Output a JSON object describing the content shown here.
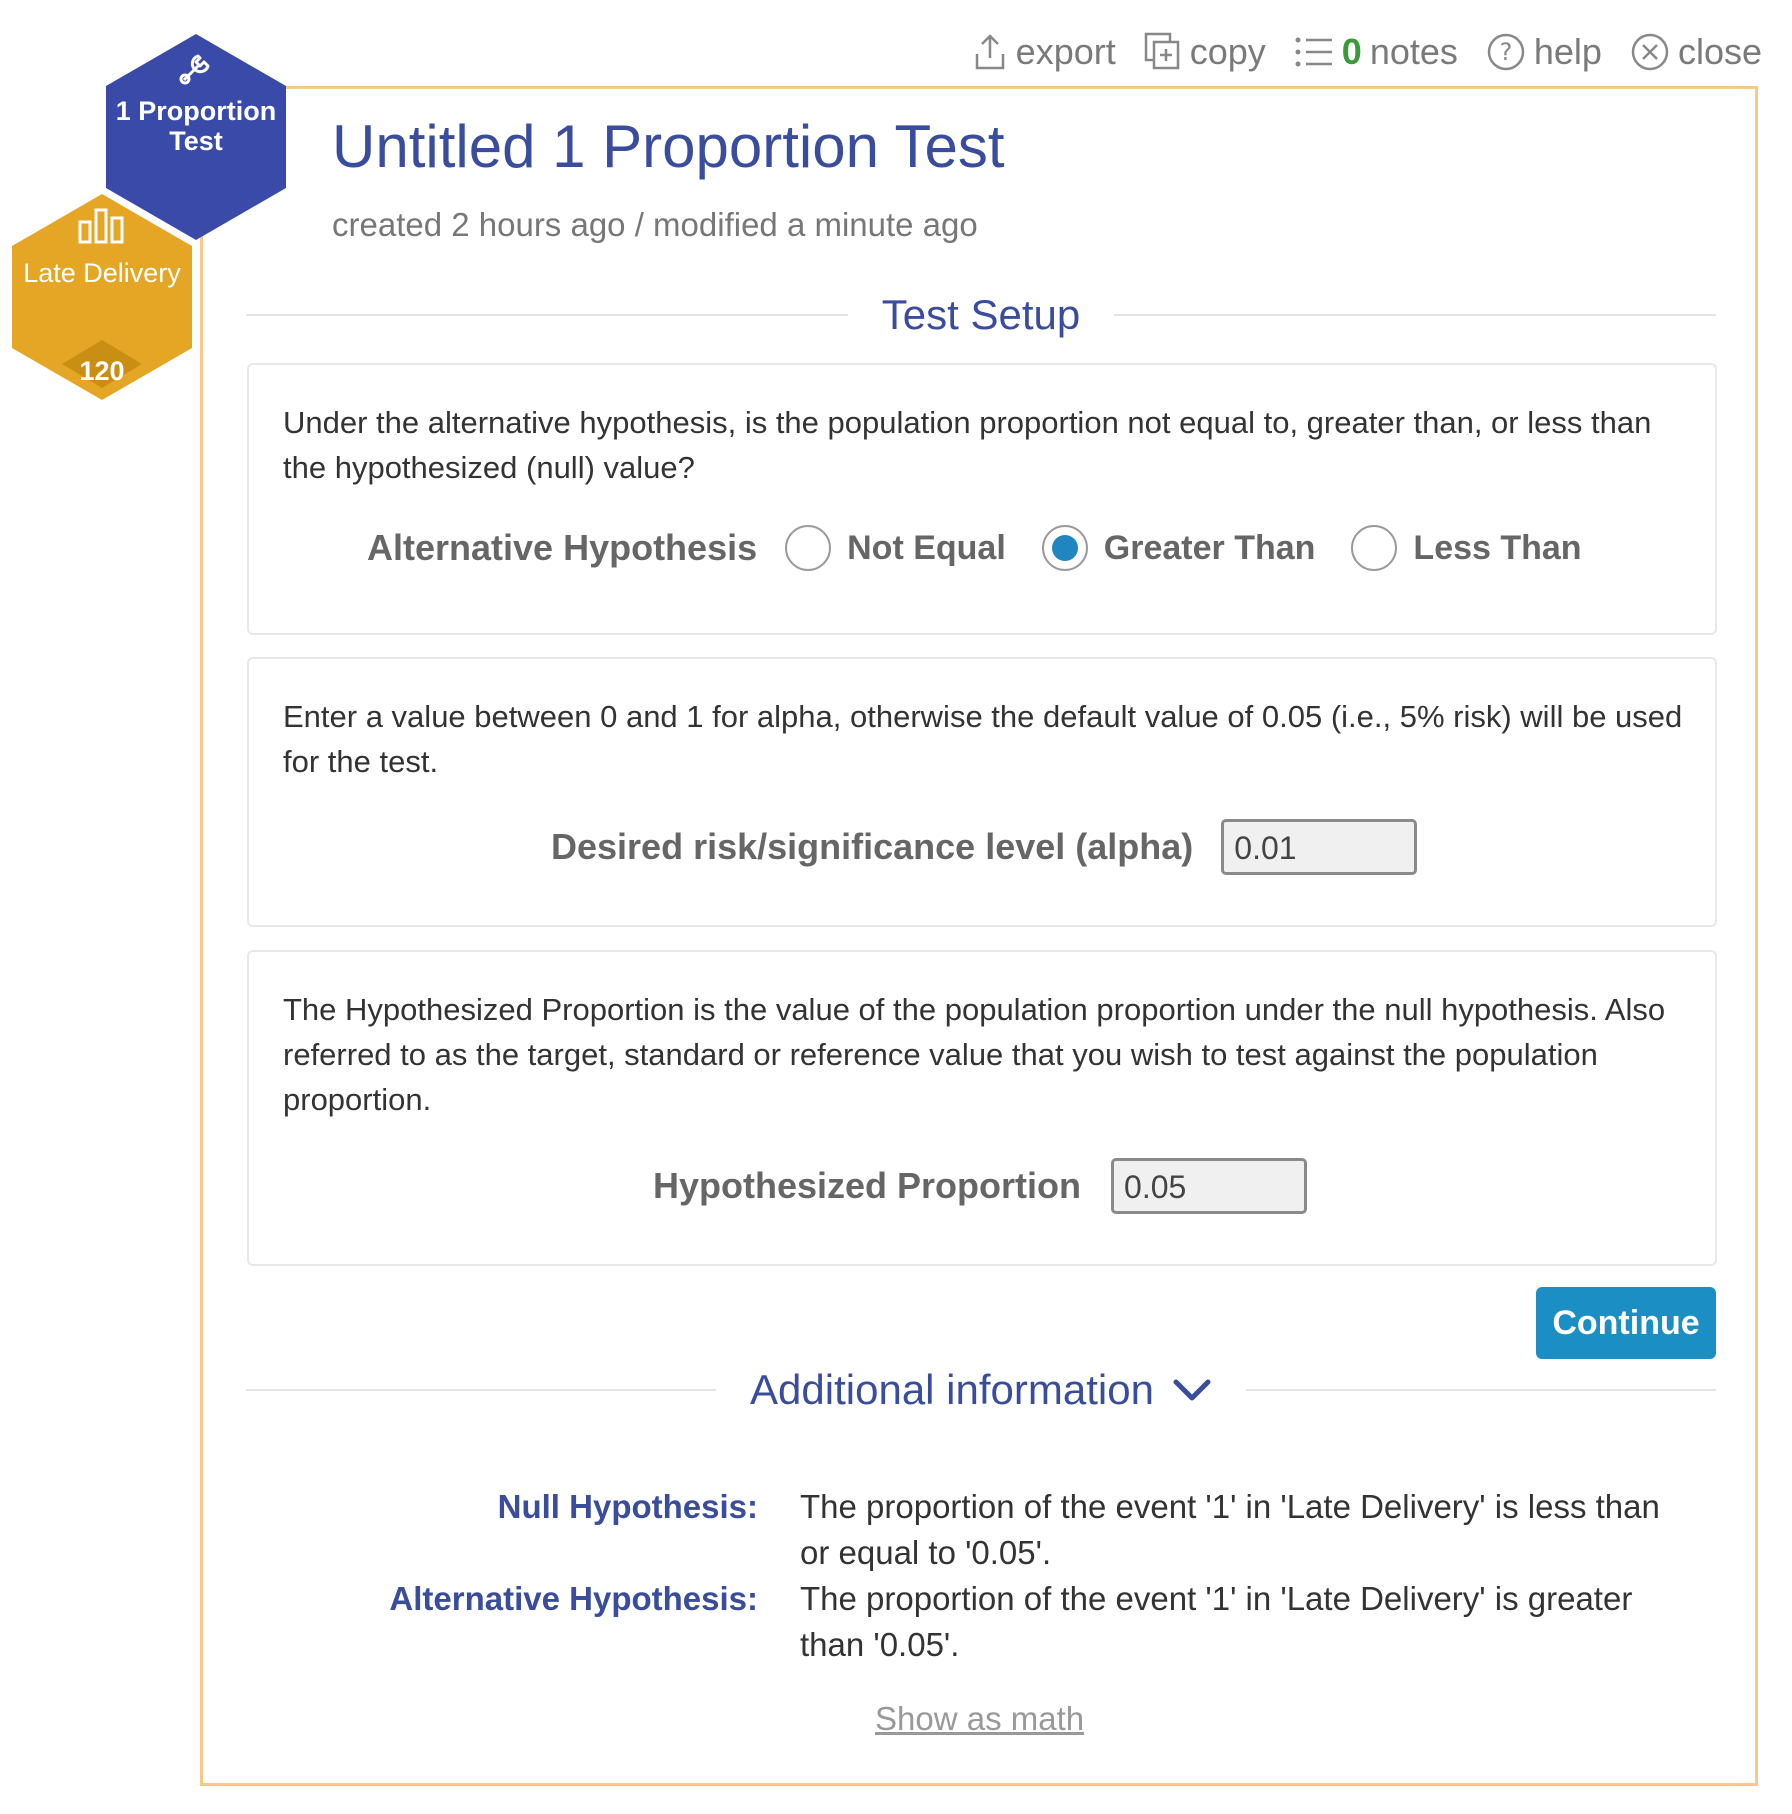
{
  "toolbar": {
    "export": "export",
    "copy": "copy",
    "notes_count": "0",
    "notes": "notes",
    "help": "help",
    "close": "close"
  },
  "hexes": {
    "test_label": "1 Proportion Test",
    "dataset_label": "Late Delivery",
    "dataset_count": "120",
    "colors": {
      "test": "#3a4aa8",
      "dataset": "#e5a625"
    }
  },
  "header": {
    "title": "Untitled 1 Proportion Test",
    "meta": "created 2 hours ago / modified a minute ago"
  },
  "setup": {
    "heading": "Test Setup",
    "hypothesis_card": {
      "description": "Under the alternative hypothesis, is the population proportion not equal to, greater than, or less than the hypothesized (null) value?",
      "label": "Alternative Hypothesis",
      "options": [
        "Not Equal",
        "Greater Than",
        "Less Than"
      ],
      "selected": "Greater Than"
    },
    "alpha_card": {
      "description": "Enter a value between 0 and 1 for alpha, otherwise the default value of 0.05 (i.e., 5% risk) will be used for the test.",
      "label": "Desired risk/significance level (alpha)",
      "value": "0.01"
    },
    "proportion_card": {
      "description": "The Hypothesized Proportion is the value of the population proportion under the null hypothesis. Also referred to as the target, standard or reference value that you wish to test against the population proportion.",
      "label": "Hypothesized Proportion",
      "value": "0.05"
    },
    "continue_label": "Continue"
  },
  "additional": {
    "heading": "Additional information",
    "null_label": "Null Hypothesis:",
    "null_text": "The proportion of the event '1' in 'Late Delivery' is less than or equal to '0.05'.",
    "alt_label": "Alternative Hypothesis:",
    "alt_text": "The proportion of the event '1' in 'Late Delivery' is greater than '0.05'.",
    "show_math": "Show as math"
  },
  "colors": {
    "accent_blue": "#3a4d9c",
    "button_blue": "#1b8fc4",
    "panel_border": "#f4c98a"
  }
}
